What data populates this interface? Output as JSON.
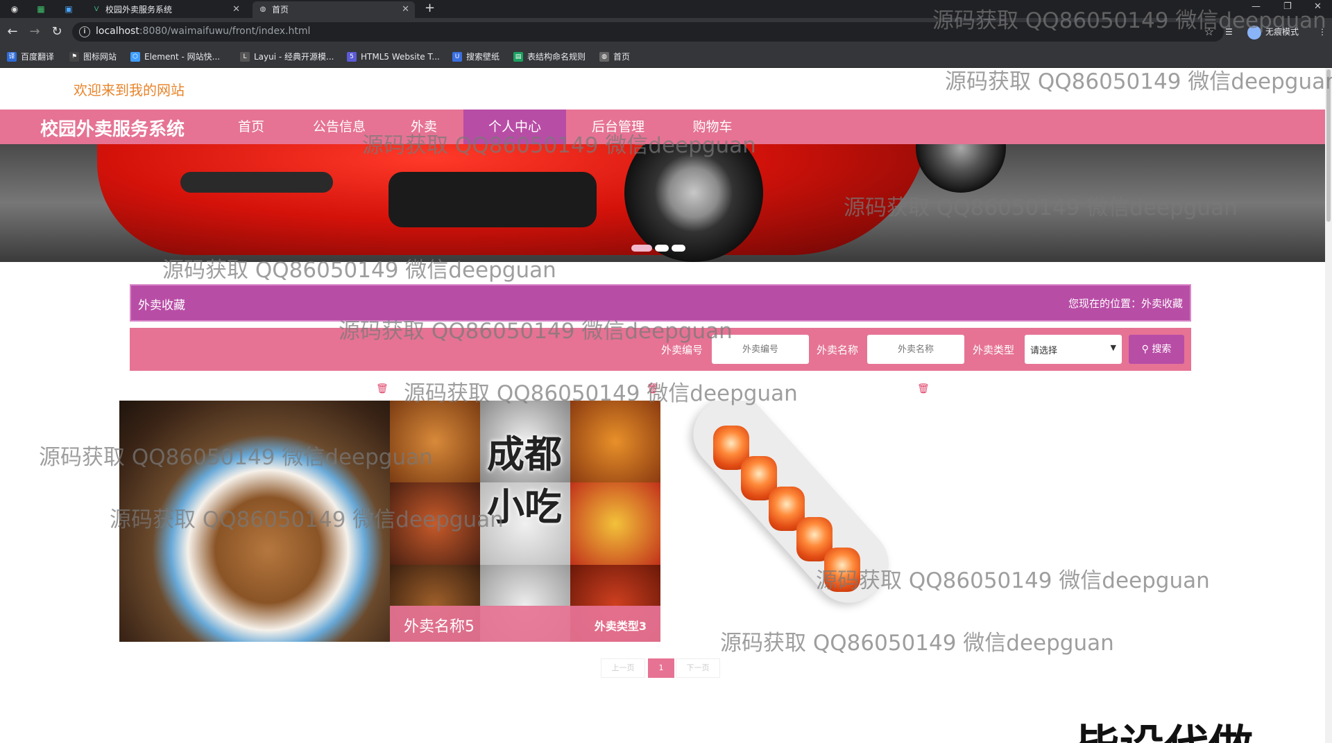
{
  "browser": {
    "tabs": [
      {
        "title": "校园外卖服务系统"
      },
      {
        "title": "首页"
      }
    ],
    "url_host": "localhost",
    "url_path": ":8080/waimaifuwu/front/index.html",
    "incognito_label": "无痕模式",
    "bookmarks": [
      {
        "label": "百度翻译",
        "color": "#2f6bd8"
      },
      {
        "label": "图标网站",
        "color": "#444"
      },
      {
        "label": "Element - 网站快...",
        "color": "#409eff"
      },
      {
        "label": "Layui - 经典开源模...",
        "color": "#555"
      },
      {
        "label": "HTML5 Website T...",
        "color": "#5b5bd6"
      },
      {
        "label": "搜索壁纸",
        "color": "#3b6fe0"
      },
      {
        "label": "表结构命名规则",
        "color": "#1aa260"
      },
      {
        "label": "首页",
        "color": "#666"
      }
    ]
  },
  "site": {
    "welcome": "欢迎来到我的网站",
    "brand": "校园外卖服务系统",
    "nav": [
      {
        "label": "首页"
      },
      {
        "label": "公告信息"
      },
      {
        "label": "外卖"
      },
      {
        "label": "个人中心",
        "active": true
      },
      {
        "label": "后台管理"
      },
      {
        "label": "购物车"
      }
    ]
  },
  "banner": {
    "slides": 3,
    "active_slide": 1
  },
  "section": {
    "title": "外卖收藏",
    "location": "您现在的位置：外卖收藏"
  },
  "search": {
    "code_label": "外卖编号",
    "code_placeholder": "外卖编号",
    "name_label": "外卖名称",
    "name_placeholder": "外卖名称",
    "type_label": "外卖类型",
    "type_selected": "请选择",
    "button": "搜索"
  },
  "cards": [
    {
      "image": "noodle"
    },
    {
      "image": "chengdu",
      "image_text": "成都小吃",
      "name": "外卖名称5",
      "type": "外卖类型3"
    },
    {
      "image": "sushi"
    }
  ],
  "pagination": {
    "prev": "上一页",
    "current": "1",
    "next": "下一页"
  },
  "watermark": "源码获取 QQ86050149 微信deepguan",
  "overlay_text": "毕设代做",
  "colors": {
    "nav_pink": "#e67394",
    "accent_purple": "#b84da6",
    "welcome_orange": "#e8842b"
  }
}
